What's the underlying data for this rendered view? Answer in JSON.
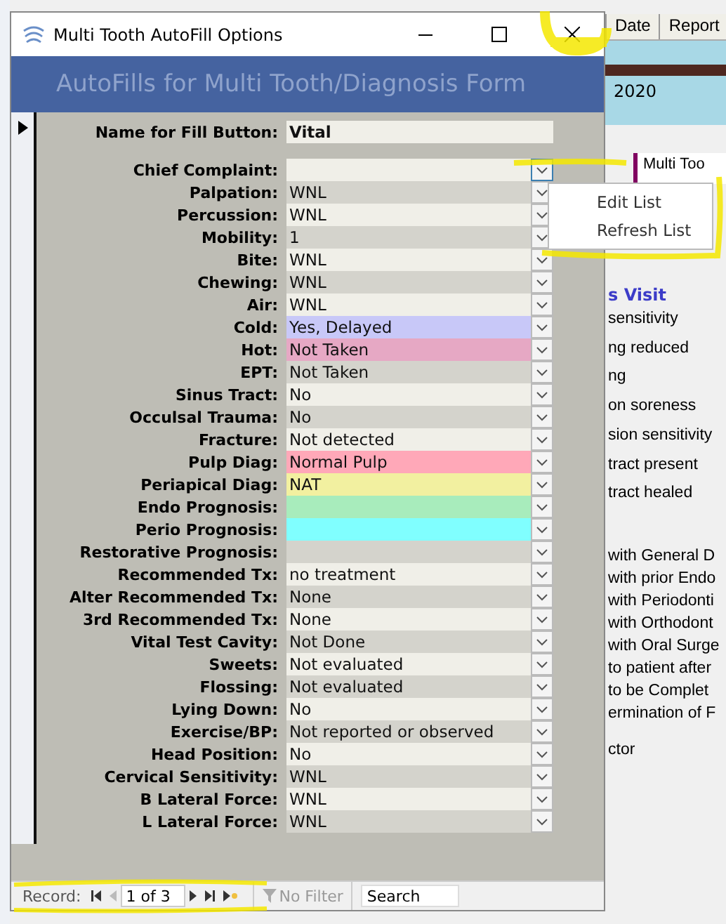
{
  "window": {
    "title": "Multi Tooth AutoFill Options"
  },
  "header": {
    "title": "AutoFills for Multi Tooth/Diagnosis Form"
  },
  "name_field": {
    "label": "Name for Fill Button:",
    "value": "Vital"
  },
  "fields": [
    {
      "label": "Chief Complaint:"
    },
    {
      "label": "Palpation:",
      "value": "WNL"
    },
    {
      "label": "Percussion:",
      "value": "WNL"
    },
    {
      "label": "Mobility:",
      "value": "1"
    },
    {
      "label": "Bite:",
      "value": "WNL"
    },
    {
      "label": "Chewing:",
      "value": "WNL"
    },
    {
      "label": "Air:",
      "value": "WNL"
    },
    {
      "label": "Cold:",
      "value": "Yes, Delayed",
      "color": "#c8c8f8"
    },
    {
      "label": "Hot:",
      "value": "Not Taken",
      "color": "#e6a8c4"
    },
    {
      "label": "EPT:",
      "value": "Not Taken"
    },
    {
      "label": "Sinus Tract:",
      "value": "No"
    },
    {
      "label": "Occulsal Trauma:",
      "value": "No"
    },
    {
      "label": "Fracture:",
      "value": "Not detected"
    },
    {
      "label": "Pulp Diag:",
      "value": "Normal Pulp",
      "color": "#ffa8b8"
    },
    {
      "label": "Periapical Diag:",
      "value": "NAT",
      "color": "#f2f0a0"
    },
    {
      "label": "Endo Prognosis:",
      "color": "#a8ecbc"
    },
    {
      "label": "Perio Prognosis:",
      "color": "#80ffff"
    },
    {
      "label": "Restorative Prognosis:"
    },
    {
      "label": "Recommended Tx:",
      "value": "no treatment"
    },
    {
      "label": "Alter Recommended Tx:",
      "value": "None"
    },
    {
      "label": "3rd Recommended Tx:",
      "value": "None"
    },
    {
      "label": "Vital Test Cavity:",
      "value": "Not Done"
    },
    {
      "label": "Sweets:",
      "value": "Not evaluated"
    },
    {
      "label": "Flossing:",
      "value": "Not evaluated"
    },
    {
      "label": "Lying Down:",
      "value": "No"
    },
    {
      "label": "Exercise/BP:",
      "value": "Not reported or observed"
    },
    {
      "label": "Head Position:",
      "value": "No"
    },
    {
      "label": "Cervical Sensitivity:",
      "value": "WNL"
    },
    {
      "label": "B Lateral Force:",
      "value": "WNL"
    },
    {
      "label": "L Lateral Force:",
      "value": "WNL"
    }
  ],
  "context_menu": {
    "items": [
      "Edit List",
      "Refresh List"
    ]
  },
  "navigation": {
    "label": "Record:",
    "position": "1 of 3",
    "filter": "No Filter",
    "search_placeholder": "Search"
  },
  "background": {
    "columns": [
      "Date",
      "Report"
    ],
    "date": "2020",
    "tab": "Multi Too",
    "section_title": "s Visit",
    "lines": [
      "sensitivity",
      "ng reduced",
      "ng",
      "on soreness",
      "sion sensitivity",
      "tract present",
      "tract healed"
    ],
    "lines_2": [
      "with General D",
      "with prior Endo",
      "with Periodonti",
      "with Orthodont",
      "with Oral Surge",
      "to patient after",
      "to be Complet",
      "ermination of F"
    ],
    "footer_line": "ctor"
  }
}
